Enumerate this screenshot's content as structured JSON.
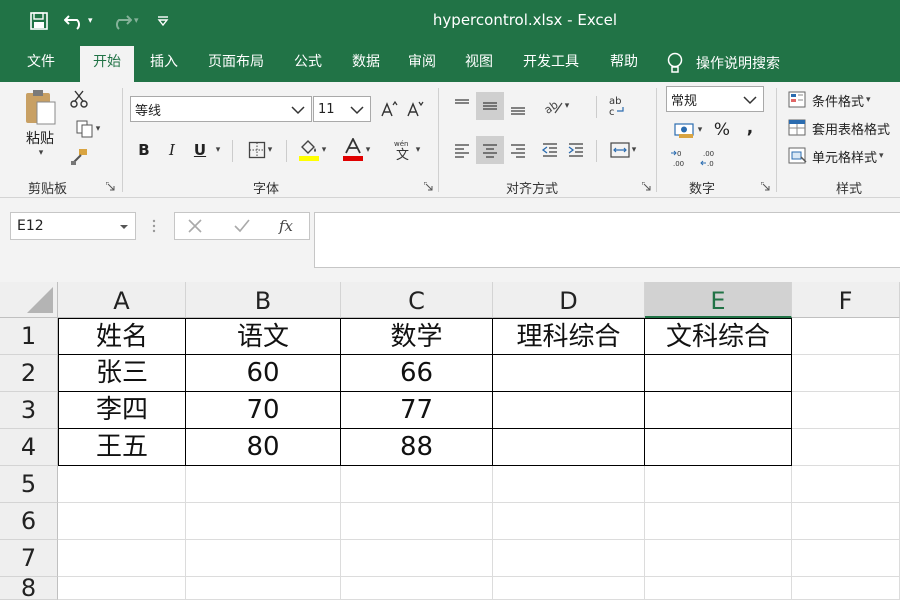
{
  "window": {
    "doc_title": "hypercontrol.xlsx  -  Excel"
  },
  "tabs": [
    {
      "label": "文件"
    },
    {
      "label": "开始"
    },
    {
      "label": "插入"
    },
    {
      "label": "页面布局"
    },
    {
      "label": "公式"
    },
    {
      "label": "数据"
    },
    {
      "label": "审阅"
    },
    {
      "label": "视图"
    },
    {
      "label": "开发工具"
    },
    {
      "label": "帮助"
    }
  ],
  "search": {
    "label": "操作说明搜索"
  },
  "ribbon": {
    "clipboard": {
      "paste_label": "粘贴",
      "group_label": "剪贴板"
    },
    "font": {
      "font_name": "等线",
      "font_size": "11",
      "group_label": "字体",
      "bold": "B",
      "italic": "I",
      "underline": "U"
    },
    "alignment": {
      "group_label": "对齐方式"
    },
    "number": {
      "format": "常规",
      "group_label": "数字",
      "percent": "%",
      "comma": ","
    },
    "styles": {
      "conditional": "条件格式",
      "table": "套用表格格式",
      "cell": "单元格样式",
      "group_label": "样式"
    }
  },
  "formula_bar": {
    "name_box": "E12",
    "formula": ""
  },
  "sheet": {
    "columns": [
      "A",
      "B",
      "C",
      "D",
      "E",
      "F"
    ],
    "selected_column": "E",
    "rows": [
      "1",
      "2",
      "3",
      "4",
      "5",
      "6",
      "7",
      "8"
    ],
    "cells": [
      [
        "姓名",
        "语文",
        "数学",
        "理科综合",
        "文科综合"
      ],
      [
        "张三",
        "60",
        "66",
        "",
        ""
      ],
      [
        "李四",
        "70",
        "77",
        "",
        ""
      ],
      [
        "王五",
        "80",
        "88",
        "",
        ""
      ]
    ]
  },
  "colors": {
    "accent": "#217346",
    "ribbon_bg": "#f3f3f3"
  }
}
